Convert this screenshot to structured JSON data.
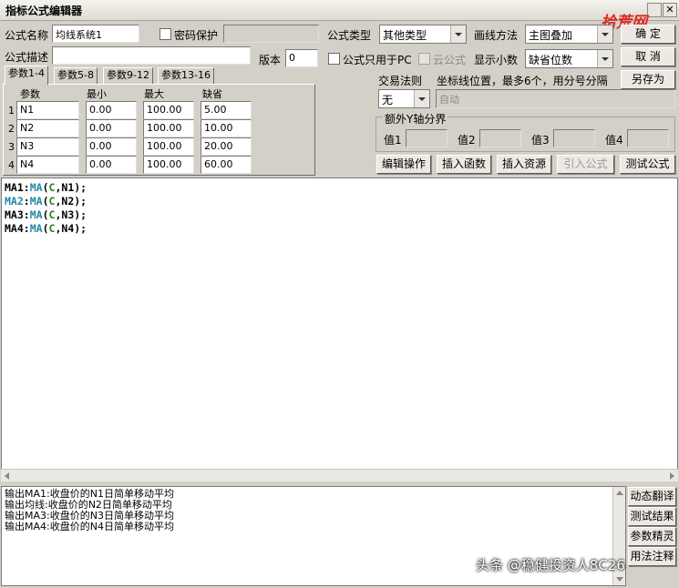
{
  "window": {
    "title": "指标公式编辑器"
  },
  "logo_text": "拾荒网",
  "form": {
    "name_label": "公式名称",
    "name_value": "均线系统1",
    "password_label": "密码保护",
    "type_label": "公式类型",
    "type_value": "其他类型",
    "draw_label": "画线方法",
    "draw_value": "主图叠加",
    "desc_label": "公式描述",
    "desc_value": "",
    "version_label": "版本",
    "version_value": "0",
    "pc_only_label": "公式只用于PC",
    "cloud_label": "云公式",
    "decimal_label": "显示小数",
    "decimal_value": "缺省位数"
  },
  "buttons": {
    "ok": "确  定",
    "cancel": "取  消",
    "save_as": "另存为",
    "edit_op": "编辑操作",
    "insert_func": "插入函数",
    "insert_res": "插入资源",
    "import": "引入公式",
    "test": "测试公式",
    "dyn_translate": "动态翻译",
    "test_result": "测试结果",
    "param_wizard": "参数精灵",
    "usage_note": "用法注释"
  },
  "tabs": [
    "参数1-4",
    "参数5-8",
    "参数9-12",
    "参数13-16"
  ],
  "params": {
    "headers": [
      "参数",
      "最小",
      "最大",
      "缺省"
    ],
    "rows": [
      {
        "idx": "1",
        "name": "N1",
        "min": "0.00",
        "max": "100.00",
        "default": "5.00"
      },
      {
        "idx": "2",
        "name": "N2",
        "min": "0.00",
        "max": "100.00",
        "default": "10.00"
      },
      {
        "idx": "3",
        "name": "N3",
        "min": "0.00",
        "max": "100.00",
        "default": "20.00"
      },
      {
        "idx": "4",
        "name": "N4",
        "min": "0.00",
        "max": "100.00",
        "default": "60.00"
      }
    ]
  },
  "trade": {
    "rule_label": "交易法则",
    "coord_label": "坐标线位置，最多6个，用分号分隔",
    "rule_value": "无",
    "coord_value": "自动",
    "yaxis_group": "额外Y轴分界",
    "value_labels": [
      "值1",
      "值2",
      "值3",
      "值4"
    ]
  },
  "code": [
    {
      "var": "MA1",
      "n": "N1"
    },
    {
      "var": "MA2",
      "n": "N2"
    },
    {
      "var": "MA3",
      "n": "N3"
    },
    {
      "var": "MA4",
      "n": "N4"
    }
  ],
  "code_tokens": {
    "func": "MA",
    "arg": "C"
  },
  "output_lines": [
    "输出MA1:收盘价的N1日简单移动平均",
    "输出均线:收盘价的N2日简单移动平均",
    "输出MA3:收盘价的N3日简单移动平均",
    "输出MA4:收盘价的N4日简单移动平均"
  ],
  "watermark": "头条 @稳健投资人8C26"
}
